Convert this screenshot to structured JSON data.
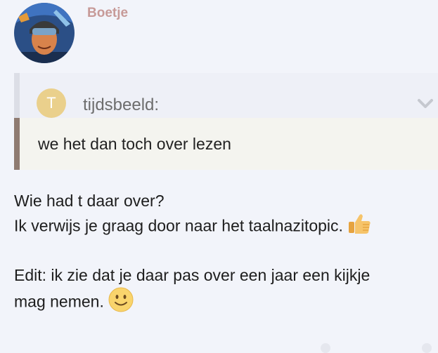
{
  "post": {
    "username": "Boetje",
    "quote": {
      "avatar_letter": "T",
      "author": "tijdsbeeld:",
      "text": "we het dan toch over lezen"
    },
    "paragraph1_line1": "Wie had t daar over?",
    "paragraph1_line2": "Ik verwijs je graag door naar het taalnazitopic.",
    "paragraph2_line1": "Edit: ik zie dat je daar pas over een jaar een kijkje",
    "paragraph2_line2": "mag nemen."
  },
  "colors": {
    "username": "#c79a98",
    "quote_avatar": "#ead08c",
    "quote_bar": "#8f7b71",
    "background": "#f2f4fa"
  },
  "icons": {
    "quote_toggle": "chevron-icon",
    "emoji1": "thumbs-up-icon",
    "emoji2": "slightly-smiling-face-icon"
  }
}
